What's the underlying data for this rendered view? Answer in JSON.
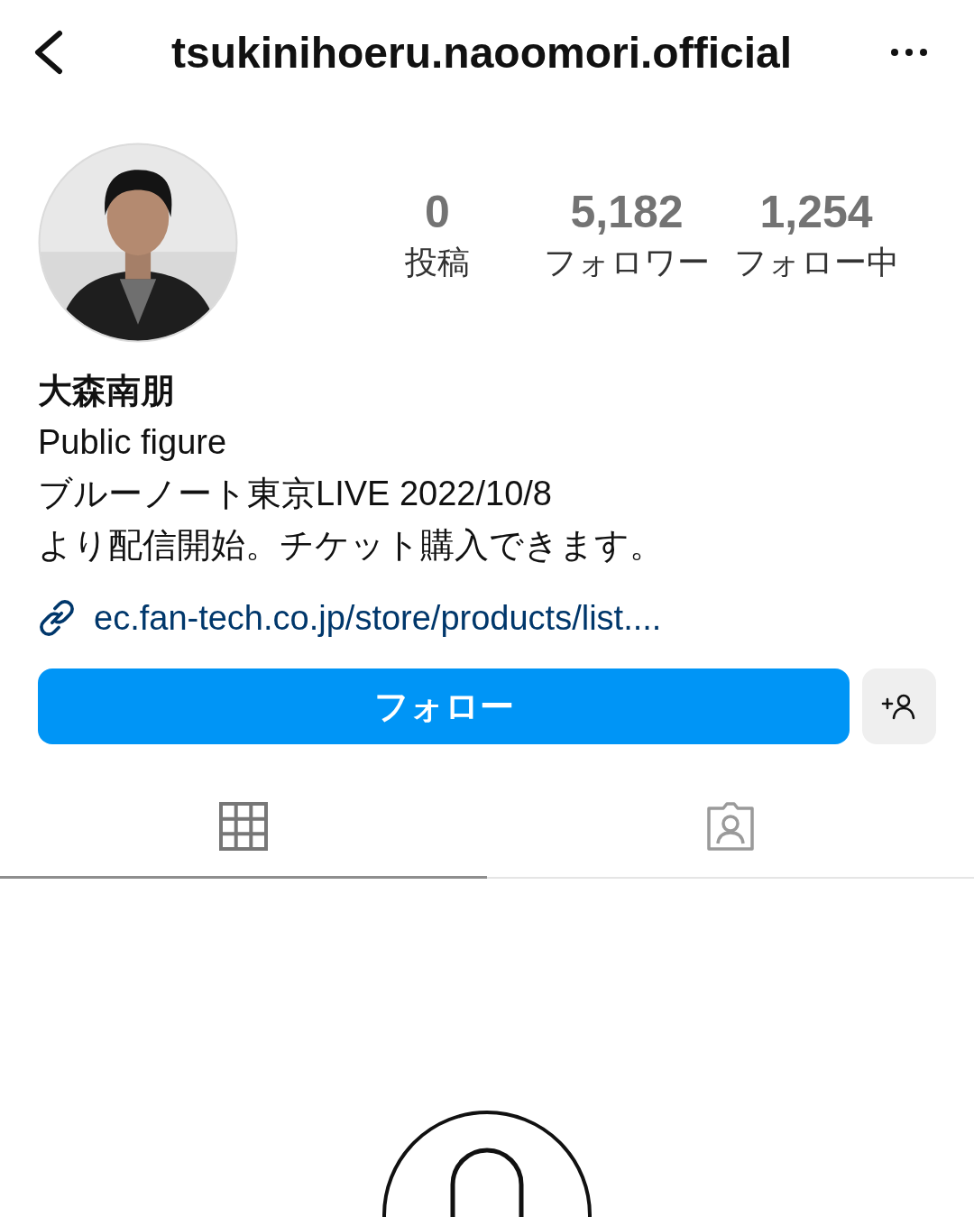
{
  "header": {
    "title": "tsukinihoeru.naoomori.official"
  },
  "profile": {
    "avatar": {
      "kind": "picture"
    },
    "stats": [
      {
        "value": "0",
        "label": "投稿"
      },
      {
        "value": "5,182",
        "label": "フォロワー"
      },
      {
        "value": "1,254",
        "label": "フォロー中"
      }
    ],
    "name": "大森南朋",
    "category": "Public figure",
    "bio": [
      "ブルーノート東京LIVE 2022/10/8",
      "より配信開始。チケット購入できます。"
    ],
    "link": "ec.fan-tech.co.jp/store/products/list...."
  },
  "actions": {
    "follow": "フォロー"
  },
  "tabs": [
    {
      "kind": "grid",
      "selected": true
    },
    {
      "kind": "tagged",
      "selected": false
    }
  ]
}
